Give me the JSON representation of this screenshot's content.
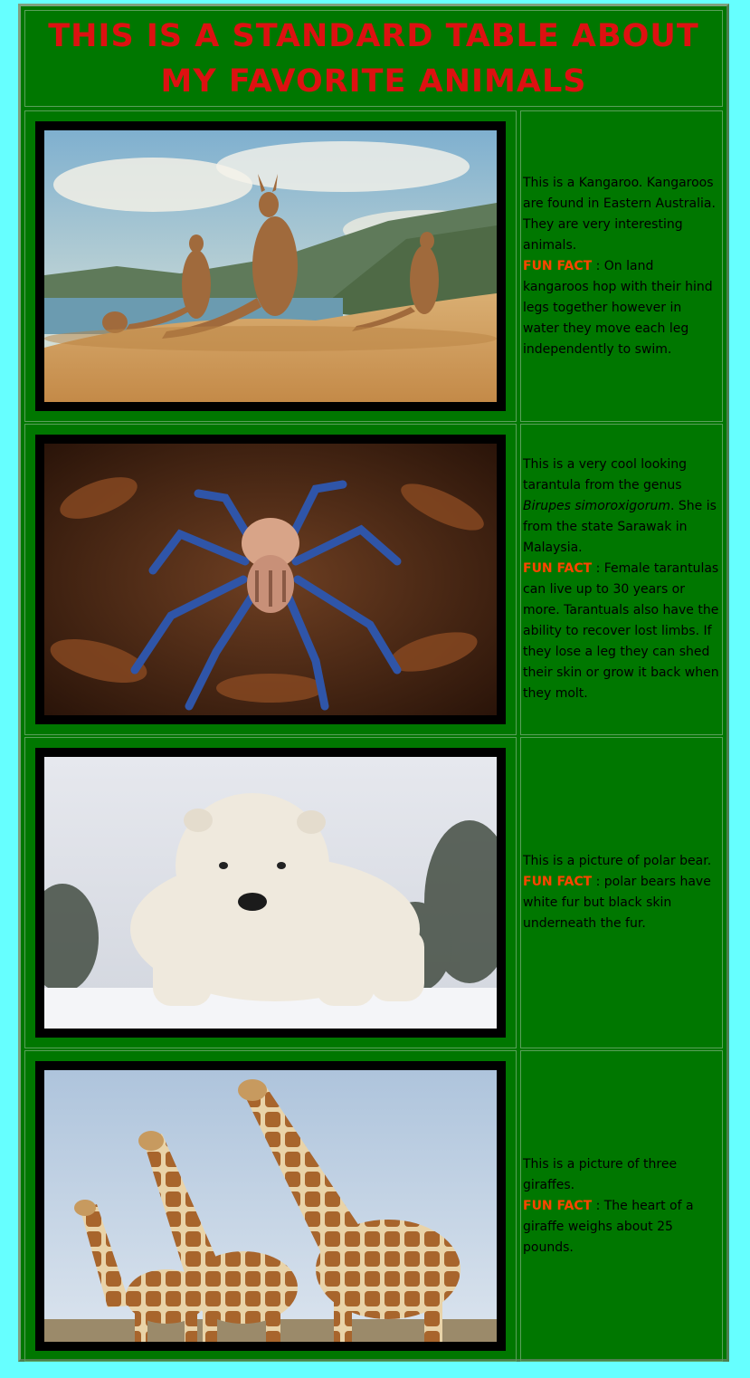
{
  "page": {
    "title": "THIS IS A STANDARD TABLE ABOUT MY FAVORITE ANIMALS"
  },
  "colors": {
    "page_background": "#66ffff",
    "table_background": "#007700",
    "title_text": "#dd1111",
    "fun_fact_label": "#ff4400"
  },
  "rows": [
    {
      "image": "kangaroos-photo",
      "text_before": "This is a Kangaroo. Kangaroos are found in Eastern Australia. They are very interesting animals.",
      "fun_fact_label": "FUN FACT",
      "fun_fact_text": " : On land kangaroos hop with their hind legs together however in water they move each leg independently to swim."
    },
    {
      "image": "tarantula-photo",
      "text_before": "This is a very cool looking tarantula from the genus ",
      "scientific_name": "Birupes simoroxigorum",
      "text_after": ". She is from the state Sarawak in Malaysia.",
      "fun_fact_label": "FUN FACT",
      "fun_fact_text": " : Female tarantulas can live up to 30 years or more. Tarantuals also have the ability to recover lost limbs. If they lose a leg they can shed their skin or grow it back when they molt."
    },
    {
      "image": "polar-bear-photo",
      "text_before": "This is a picture of polar bear.",
      "fun_fact_label": "FUN FACT",
      "fun_fact_text": " : polar bears have white fur but black skin underneath the fur."
    },
    {
      "image": "giraffes-photo",
      "text_before": "This is a picture of three giraffes.",
      "fun_fact_label": "FUN FACT",
      "fun_fact_text": " : The heart of a giraffe weighs about 25 pounds."
    }
  ]
}
